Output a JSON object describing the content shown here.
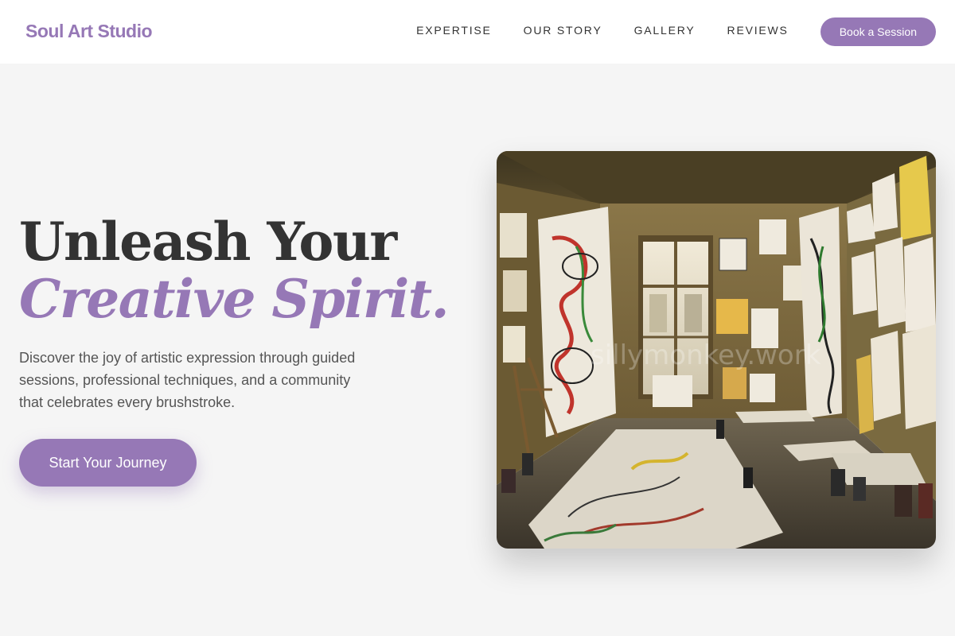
{
  "brand": {
    "name": "Soul Art Studio"
  },
  "nav": {
    "items": [
      {
        "label": "EXPERTISE"
      },
      {
        "label": "OUR STORY"
      },
      {
        "label": "GALLERY"
      },
      {
        "label": "REVIEWS"
      }
    ],
    "cta_label": "Book a Session"
  },
  "hero": {
    "title_line_1": "Unleash Your",
    "title_line_2": "Creative Spirit.",
    "description": "Discover the joy of artistic expression through guided sessions, professional techniques, and a community that celebrates every brushstroke.",
    "cta_label": "Start Your Journey",
    "image": {
      "watermark": "sillymonkey.work"
    }
  },
  "colors": {
    "accent": "#9678b6",
    "heading": "#333333",
    "body_text": "#555555",
    "background": "#f5f5f5",
    "header_bg": "#ffffff"
  }
}
